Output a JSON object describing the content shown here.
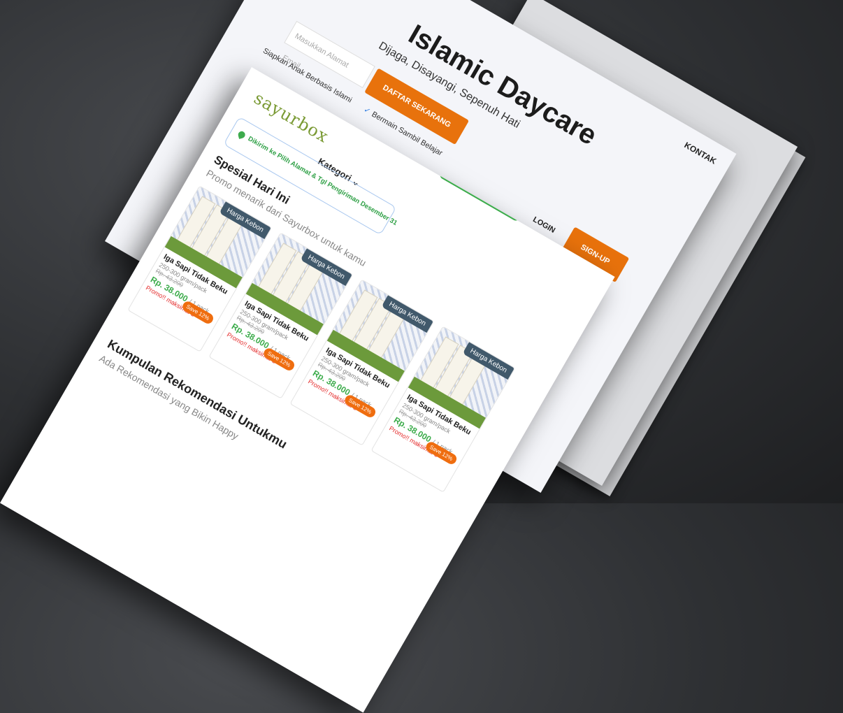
{
  "back_page": {
    "title": "Islamic Daycare",
    "subtitle": "Dijaga, Disayangi, Sepenuh Hati",
    "nav": [
      "KONTAK"
    ],
    "email_placeholder": "Masukkan Alamat Email",
    "cta_button": "DAFTAR SEKARANG",
    "bullets": [
      "Siapkan Anak Berbasis Islami",
      "Bermain Sambil Belajar"
    ],
    "login_label": "LOGIN",
    "signup_label": "SIGN-UP"
  },
  "front_page": {
    "logo": "sayurbox",
    "kategori_label": "Kategori",
    "delivery_text": "Dikirim ke Pilih Alamat & Tgl Pengiriman Desember 31",
    "section1": {
      "title": "Spesial Hari Ini",
      "subtitle": "Promo menarik dari Sayurbox untuk kamu"
    },
    "section2": {
      "title": "Kumpulan Rekomendasi Untukmu",
      "subtitle": "Ada Rekomendasi yang Bikin Happy"
    },
    "login_button": "Login",
    "products": [
      {
        "tag": "Harga Kebon",
        "name": "Iga Sapi Tidak Beku",
        "weight": "250-300 gram/pack",
        "old_price": "Rp. 43.200",
        "price": "Rp. 38.000",
        "unit": "/ 1 pack",
        "save": "Save 12%",
        "promo": "Promo!! maksimal 3"
      },
      {
        "tag": "Harga Kebon",
        "name": "Iga Sapi Tidak Beku",
        "weight": "250-300 gram/pack",
        "old_price": "Rp. 43.200",
        "price": "Rp. 38.000",
        "unit": "/ 1 pack",
        "save": "Save 12%",
        "promo": "Promo!! maksimal 3"
      },
      {
        "tag": "Harga Kebon",
        "name": "Iga Sapi Tidak Beku",
        "weight": "250-300 gram/pack",
        "old_price": "Rp. 43.200",
        "price": "Rp. 38.000",
        "unit": "/ 1 pack",
        "save": "Save 12%",
        "promo": "Promo!! maksimal 3"
      },
      {
        "tag": "Harga Kebon",
        "name": "Iga Sapi Tidak Beku",
        "weight": "250-300 gram/pack",
        "old_price": "Rp. 43.200",
        "price": "Rp. 38.000",
        "unit": "/ 1 pack",
        "save": "Save 12%",
        "promo": "Promo!! maksimal 3"
      }
    ]
  },
  "colors": {
    "orange": "#e8720c",
    "green": "#3cac4b",
    "tag": "#41596b",
    "promo_red": "#e42b2b"
  }
}
